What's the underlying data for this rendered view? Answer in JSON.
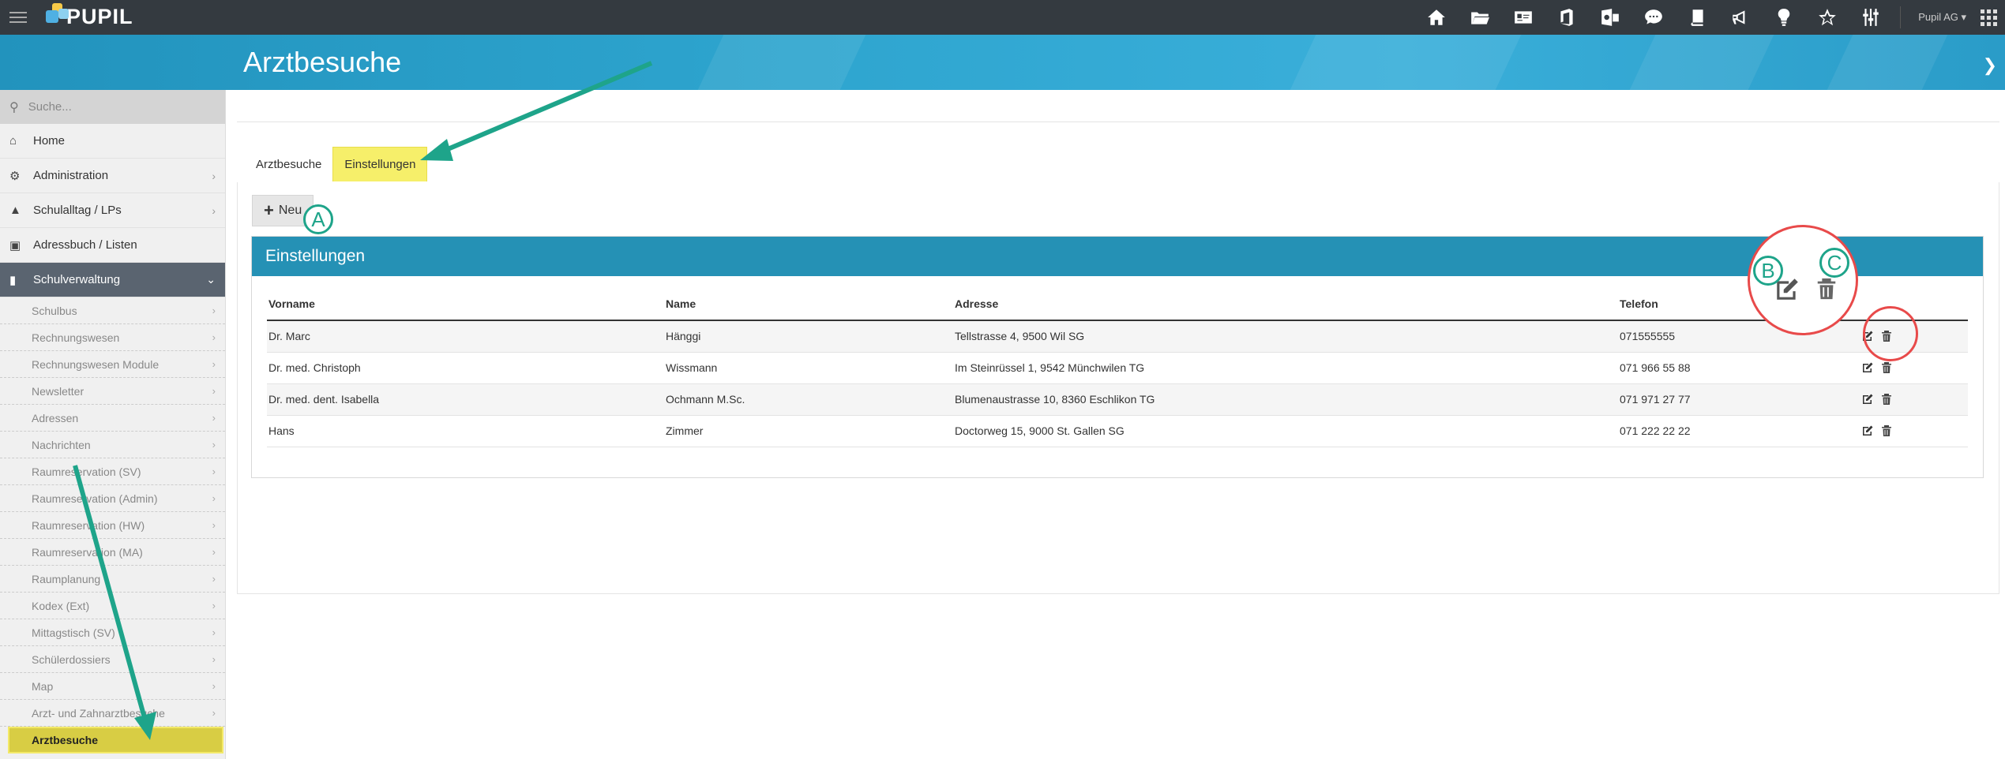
{
  "app": {
    "name": "PUPIL",
    "user": "Pupil AG ▾"
  },
  "topbar": {
    "icons": [
      "home-icon",
      "folder-icon",
      "addressbook-icon",
      "office-icon",
      "outlook-icon",
      "chat-icon",
      "book-icon",
      "megaphone-icon",
      "lightbulb-icon",
      "star-icon",
      "sliders-icon"
    ]
  },
  "header": {
    "title": "Arztbesuche"
  },
  "sidebar": {
    "search_placeholder": "Suche...",
    "items": [
      {
        "label": "Home",
        "icon": "home-icon"
      },
      {
        "label": "Administration",
        "icon": "gears-icon"
      },
      {
        "label": "Schulalltag / LPs",
        "icon": "graduation-cap-icon"
      },
      {
        "label": "Adressbuch / Listen",
        "icon": "addresscard-icon"
      },
      {
        "label": "Schulverwaltung",
        "icon": "folder-open-icon"
      }
    ],
    "subitems": [
      "Schulbus",
      "Rechnungswesen",
      "Rechnungswesen Module",
      "Newsletter",
      "Adressen",
      "Nachrichten",
      "Raumreservation (SV)",
      "Raumreservation (Admin)",
      "Raumreservation (HW)",
      "Raumreservation (MA)",
      "Raumplanung",
      "Kodex (Ext)",
      "Mittagstisch (SV)",
      "Schülerdossiers",
      "Map",
      "Arzt- und Zahnarztbesuche",
      "Arztbesuche"
    ]
  },
  "tabs": [
    {
      "label": "Arztbesuche"
    },
    {
      "label": "Einstellungen"
    }
  ],
  "toolbar": {
    "new_label": "Neu"
  },
  "card": {
    "title": "Einstellungen"
  },
  "table": {
    "columns": [
      "Vorname",
      "Name",
      "Adresse",
      "Telefon"
    ],
    "rows": [
      {
        "vorname": "Dr. Marc",
        "name": "Hänggi",
        "adresse": "Tellstrasse 4, 9500 Wil SG",
        "telefon": "071555555"
      },
      {
        "vorname": "Dr. med. Christoph",
        "name": "Wissmann",
        "adresse": "Im Steinrüssel 1, 9542 Münchwilen TG",
        "telefon": "071 966 55 88"
      },
      {
        "vorname": "Dr. med. dent. Isabella",
        "name": "Ochmann M.Sc.",
        "adresse": "Blumenaustrasse 10, 8360 Eschlikon TG",
        "telefon": "071 971 27 77"
      },
      {
        "vorname": "Hans",
        "name": "Zimmer",
        "adresse": "Doctorweg 15, 9000 St. Gallen SG",
        "telefon": "071 222 22 22"
      }
    ]
  },
  "annotations": {
    "a": "A",
    "b": "B",
    "c": "C",
    "accent": "#1ea48a",
    "highlight": "#f6ef6a",
    "circle": "#e84a4a"
  }
}
